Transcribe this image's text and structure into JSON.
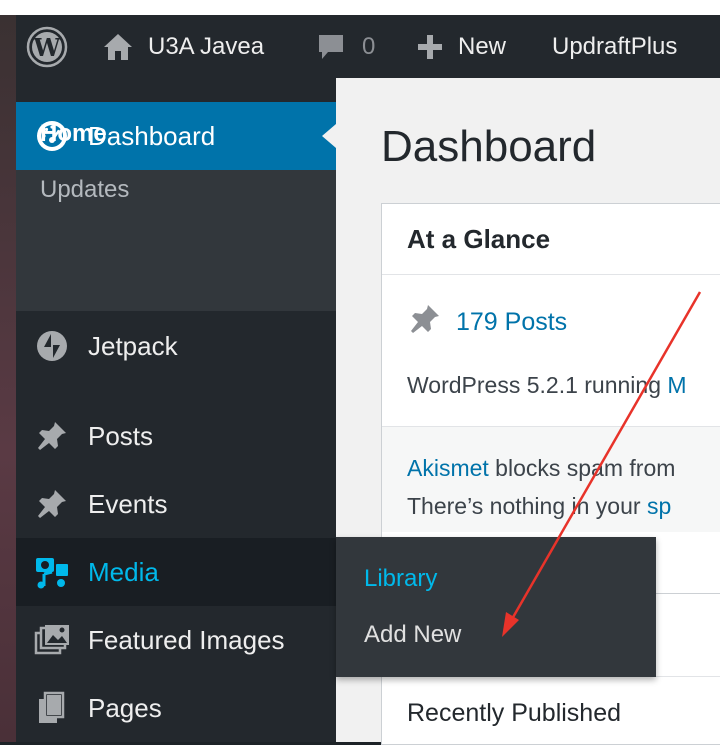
{
  "admin_bar": {
    "site_name": "U3A Javea",
    "comments_count": "0",
    "new_label": "New",
    "plugin_label": "UpdraftPlus",
    "icons": [
      "wordpress-logo-icon",
      "home-icon",
      "comment-icon",
      "plus-icon"
    ]
  },
  "sidebar": {
    "dashboard": "Dashboard",
    "submenu": {
      "home": "Home",
      "updates": "Updates"
    },
    "items": [
      {
        "label": "Jetpack",
        "icon": "jetpack-icon"
      },
      {
        "label": "Posts",
        "icon": "pushpin-icon"
      },
      {
        "label": "Events",
        "icon": "pushpin-icon"
      },
      {
        "label": "Media",
        "icon": "media-icon"
      },
      {
        "label": "Featured Images",
        "icon": "images-icon"
      },
      {
        "label": "Pages",
        "icon": "pages-icon"
      }
    ]
  },
  "flyout": {
    "library": "Library",
    "add_new": "Add New"
  },
  "main": {
    "title": "Dashboard",
    "at_a_glance": {
      "heading": "At a Glance",
      "posts": "179 Posts",
      "version_text": "WordPress 5.2.1 running ",
      "version_link": "M",
      "akismet_link": "Akismet",
      "akismet_text": " blocks spam from",
      "line2_text": "There’s nothing in your ",
      "line2_link": "sp"
    },
    "recently_published": "Recently Published"
  },
  "colors": {
    "admin_bar": "#23282d",
    "active_menu": "#0073aa",
    "highlight": "#00b9eb",
    "link": "#0073aa",
    "annotation_arrow": "#e8332a"
  }
}
